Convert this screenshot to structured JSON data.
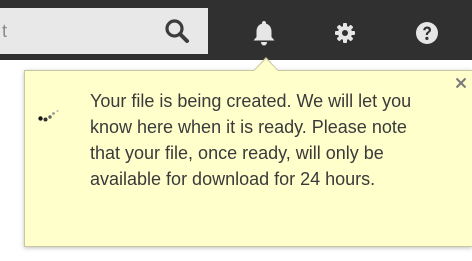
{
  "header": {
    "search": {
      "visible_text": "t"
    },
    "icons": [
      "search-icon",
      "bell-icon",
      "gear-icon",
      "help-icon"
    ]
  },
  "notification": {
    "message": "Your file is being created. We will let you know here when it is ready. Please note that your file, once ready, will only be available for download for 24 hours.",
    "close_glyph": "×",
    "status_icon": "spinner-icon"
  },
  "colors": {
    "topbar": "#303030",
    "search_bg": "#e8e8e8",
    "popover_bg": "#ffffcc",
    "text": "#3a3a3a"
  }
}
